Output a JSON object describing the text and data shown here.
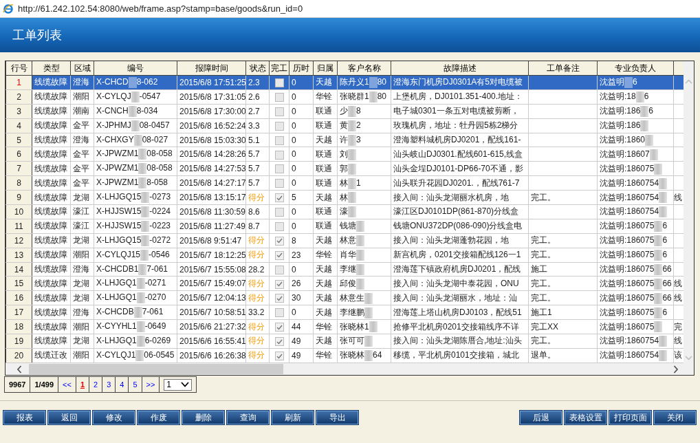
{
  "address_bar": {
    "url": "http://61.242.102.54:8080/web/frame.asp?stamp=base/goods&run_id=0"
  },
  "page_title": "工单列表",
  "table": {
    "columns": [
      "行号",
      "类型",
      "区域",
      "编号",
      "报障时间",
      "状态",
      "完工",
      "历时",
      "归属",
      "客户名称",
      "故障描述",
      "工单备注",
      "专业负责人"
    ],
    "rows": [
      {
        "row_no": "1",
        "type": "线缆故障",
        "area": "澄海",
        "number": [
          "X-CHCD",
          "8-062"
        ],
        "time": "2015/6/8 17:51:25",
        "status": "2.3",
        "scored": false,
        "done": false,
        "duration": "0",
        "owner": "天越",
        "customer": [
          "陈丹义1",
          "80"
        ],
        "description": "澄海东门机房DJ0301A有5对电缆被",
        "lead": [
          "沈益明",
          "6"
        ],
        "selected": true
      },
      {
        "row_no": "2",
        "type": "线缆故障",
        "area": "潮阳",
        "number": [
          "X-CYLQJ",
          "-0547"
        ],
        "time": "2015/6/8 17:31:05",
        "status": "2.6",
        "scored": false,
        "done": false,
        "duration": "0",
        "owner": "华铨",
        "customer": [
          "张晓群1",
          "80"
        ],
        "description": "上堡机房，DJ0101.351-400.地址：",
        "lead": [
          "沈益明:18",
          "6"
        ],
        "selected": false
      },
      {
        "row_no": "3",
        "type": "线缆故障",
        "area": "潮南",
        "number": [
          "X-CNCH",
          "8-034"
        ],
        "time": "2015/6/8 17:30:00",
        "status": "2.7",
        "scored": false,
        "done": false,
        "duration": "0",
        "owner": "联通",
        "customer": [
          "少",
          "8"
        ],
        "description": "电子城0301一条五对电缆被剪断，",
        "lead": [
          "沈益明:186",
          "6"
        ],
        "selected": false
      },
      {
        "row_no": "4",
        "type": "线缆故障",
        "area": "金平",
        "number": [
          "X-JPHMJ",
          "08-0457"
        ],
        "time": "2015/6/8 16:52:24",
        "status": "3.3",
        "scored": false,
        "done": false,
        "duration": "0",
        "owner": "联通",
        "customer": [
          "黄",
          "2"
        ],
        "description": "玫瑰机房，地址：牡丹园5栋2梯分",
        "lead": [
          "沈益明:186"
        ],
        "selected": false
      },
      {
        "row_no": "5",
        "type": "线缆故障",
        "area": "澄海",
        "number": [
          "X-CHXGY",
          "08-027"
        ],
        "time": "2015/6/8 15:03:30",
        "status": "5.1",
        "scored": false,
        "done": false,
        "duration": "0",
        "owner": "天越",
        "customer": [
          "许",
          "3"
        ],
        "description": "澄海塑料城机房DJ0201，配线161-",
        "lead": [
          "沈益明:1860"
        ],
        "selected": false
      },
      {
        "row_no": "6",
        "type": "线缆故障",
        "area": "金平",
        "number": [
          "X-JPWZM1",
          "08-058"
        ],
        "time": "2015/6/8 14:28:26",
        "status": "5.7",
        "scored": false,
        "done": false,
        "duration": "0",
        "owner": "联通",
        "customer": [
          "刘"
        ],
        "description": "汕头岐山DJ0301.配线601-615,线盒",
        "lead": [
          "沈益明:18607"
        ],
        "selected": false
      },
      {
        "row_no": "7",
        "type": "线缆故障",
        "area": "金平",
        "number": [
          "X-JPWZM1",
          "08-058"
        ],
        "time": "2015/6/8 14:27:53",
        "status": "5.7",
        "scored": false,
        "done": false,
        "duration": "0",
        "owner": "联通",
        "customer": [
          "郭"
        ],
        "description": "汕头金埕DJ0101-DP66-70不通，影",
        "lead": [
          "沈益明:186075"
        ],
        "selected": false
      },
      {
        "row_no": "8",
        "type": "线缆故障",
        "area": "金平",
        "number": [
          "X-JPWZM1",
          "8-058"
        ],
        "time": "2015/6/8 14:27:17",
        "status": "5.7",
        "scored": false,
        "done": false,
        "duration": "0",
        "owner": "联通",
        "customer": [
          "林",
          "1"
        ],
        "description": "汕头联升花园DJ0201.，配线761-7",
        "lead": [
          "沈益明:1860754"
        ],
        "selected": false
      },
      {
        "row_no": "9",
        "type": "线缆故障",
        "area": "龙湖",
        "number": [
          "X-LHJGQ15",
          "-0273"
        ],
        "time": "2015/6/8 13:15:17",
        "status": "得分",
        "scored": true,
        "done": true,
        "duration": "5",
        "owner": "天越",
        "customer": [
          "林"
        ],
        "description": "接入间：汕头龙湖丽水机房，地",
        "note": "完工。",
        "lead": [
          "沈益明:1860754"
        ],
        "column_13": "线",
        "selected": false
      },
      {
        "row_no": "10",
        "type": "线缆故障",
        "area": "濠江",
        "number": [
          "X-HJJSW15",
          "-0224"
        ],
        "time": "2015/6/8 11:30:59",
        "status": "8.6",
        "scored": false,
        "done": false,
        "duration": "0",
        "owner": "联通",
        "customer": [
          "濠"
        ],
        "description": "濠江区DJ0101DP(861-870)分线盒",
        "lead": [
          "沈益明:1860754"
        ],
        "selected": false
      },
      {
        "row_no": "11",
        "type": "线缆故障",
        "area": "濠江",
        "number": [
          "X-HJJSW15",
          "-0223"
        ],
        "time": "2015/6/8 11:27:49",
        "status": "8.7",
        "scored": false,
        "done": false,
        "duration": "0",
        "owner": "联通",
        "customer": [
          "钱塘"
        ],
        "description": "钱塘ONU372DP(086-090)分线盒电",
        "lead": [
          "沈益明:186075",
          "6"
        ],
        "selected": false
      },
      {
        "row_no": "12",
        "type": "线缆故障",
        "area": "龙湖",
        "number": [
          "X-LHJGQ15",
          "-0272"
        ],
        "time": "2015/6/8 9:51:47",
        "status": "得分",
        "scored": true,
        "done": true,
        "duration": "8",
        "owner": "天越",
        "customer": [
          "林意"
        ],
        "description": "接入间：汕头龙湖蓬勃花园，地",
        "note": "完工。",
        "lead": [
          "沈益明:186075",
          "6"
        ],
        "selected": false
      },
      {
        "row_no": "13",
        "type": "线缆故障",
        "area": "潮阳",
        "number": [
          "X-CYLQJ15",
          "-0546"
        ],
        "time": "2015/6/7 18:12:25",
        "status": "得分",
        "scored": true,
        "done": true,
        "duration": "23",
        "owner": "华铨",
        "customer": [
          "肖华"
        ],
        "description": "新宫机房，0201交接箱配线126一1",
        "note": "完工。",
        "lead": [
          "沈益明:186075",
          "6"
        ],
        "selected": false
      },
      {
        "row_no": "14",
        "type": "线缆故障",
        "area": "澄海",
        "number": [
          "X-CHCDB1",
          "7-061"
        ],
        "time": "2015/6/7 15:55:08",
        "status": "28.2",
        "scored": false,
        "done": false,
        "duration": "0",
        "owner": "天越",
        "customer": [
          "李继"
        ],
        "description": "澄海莲下镇政府机房DJ0201，配线",
        "note": "施工",
        "lead": [
          "沈益明:186075",
          "66"
        ],
        "selected": false
      },
      {
        "row_no": "15",
        "type": "线缆故障",
        "area": "龙湖",
        "number": [
          "X-LHJGQ1",
          "-0271"
        ],
        "time": "2015/6/7 15:49:07",
        "status": "得分",
        "scored": true,
        "done": true,
        "duration": "26",
        "owner": "天越",
        "customer": [
          "邱俊"
        ],
        "description": "接入间：汕头龙湖中泰花园，ONU",
        "note": "完工。",
        "lead": [
          "沈益明:186075",
          "66"
        ],
        "column_13": "线",
        "selected": false
      },
      {
        "row_no": "16",
        "type": "线缆故障",
        "area": "龙湖",
        "number": [
          "X-LHJGQ1",
          "-0270"
        ],
        "time": "2015/6/7 12:04:13",
        "status": "得分",
        "scored": true,
        "done": true,
        "duration": "30",
        "owner": "天越",
        "customer": [
          "林意生"
        ],
        "description": "接入间：汕头龙湖丽水，地址：汕",
        "note": "完工。",
        "lead": [
          "沈益明:186075",
          "66"
        ],
        "column_13": "线",
        "selected": false
      },
      {
        "row_no": "17",
        "type": "线缆故障",
        "area": "澄海",
        "number": [
          "X-CHCDB",
          "7-061"
        ],
        "time": "2015/6/7 10:58:51",
        "status": "33.2",
        "scored": false,
        "done": false,
        "duration": "0",
        "owner": "天越",
        "customer": [
          "李继鹏"
        ],
        "description": "澄海莲上塔山机房DJ0103，配线51",
        "note": "施工1",
        "lead": [
          "沈益明:186075",
          "6"
        ],
        "selected": false
      },
      {
        "row_no": "18",
        "type": "线缆故障",
        "area": "潮阳",
        "number": [
          "X-CYYHL1",
          "-0649"
        ],
        "time": "2015/6/6 21:27:32",
        "status": "得分",
        "scored": true,
        "done": true,
        "duration": "44",
        "owner": "华铨",
        "customer": [
          "张晓林1"
        ],
        "description": "抢修平北机房0201交接箱线序不详",
        "note": "完工XX",
        "lead": [
          "沈益明:186075"
        ],
        "column_13": "完",
        "selected": false
      },
      {
        "row_no": "19",
        "type": "线缆故障",
        "area": "龙湖",
        "number": [
          "X-LHJGQ1",
          "6-0269"
        ],
        "time": "2015/6/6 16:55:41",
        "status": "得分",
        "scored": true,
        "done": true,
        "duration": "49",
        "owner": "天越",
        "customer": [
          "张可可"
        ],
        "description": "接入间：汕头龙湖陈厝合,地址:汕头",
        "note": "完工。",
        "lead": [
          "沈益明:1860754"
        ],
        "column_13": "线",
        "selected": false
      },
      {
        "row_no": "20",
        "type": "线缆迁改",
        "area": "潮阳",
        "number": [
          "X-CYLQJ1",
          "06-0545"
        ],
        "time": "2015/6/6 16:26:38",
        "status": "得分",
        "scored": true,
        "done": true,
        "duration": "49",
        "owner": "华铨",
        "customer": [
          "张晓林",
          "64"
        ],
        "description": "移缆，平北机房0101交接箱，城北",
        "note": "退单。",
        "lead": [
          "沈益明:1860754"
        ],
        "column_13": "该",
        "selected": false
      }
    ]
  },
  "pager": {
    "total": "9967",
    "page_info": "1/499",
    "first": "<<",
    "pages": [
      {
        "label": "1",
        "selected": true
      },
      {
        "label": "2",
        "selected": false
      },
      {
        "label": "3",
        "selected": false
      },
      {
        "label": "4",
        "selected": false
      },
      {
        "label": "5",
        "selected": false
      }
    ],
    "last": ">>",
    "page_select": "1"
  },
  "buttons_left": [
    "报表",
    "返回",
    "修改",
    "作废",
    "删除",
    "查询",
    "刷新",
    "导出"
  ],
  "buttons_right": [
    "后退",
    "表格设置",
    "打印页面",
    "关闭"
  ]
}
